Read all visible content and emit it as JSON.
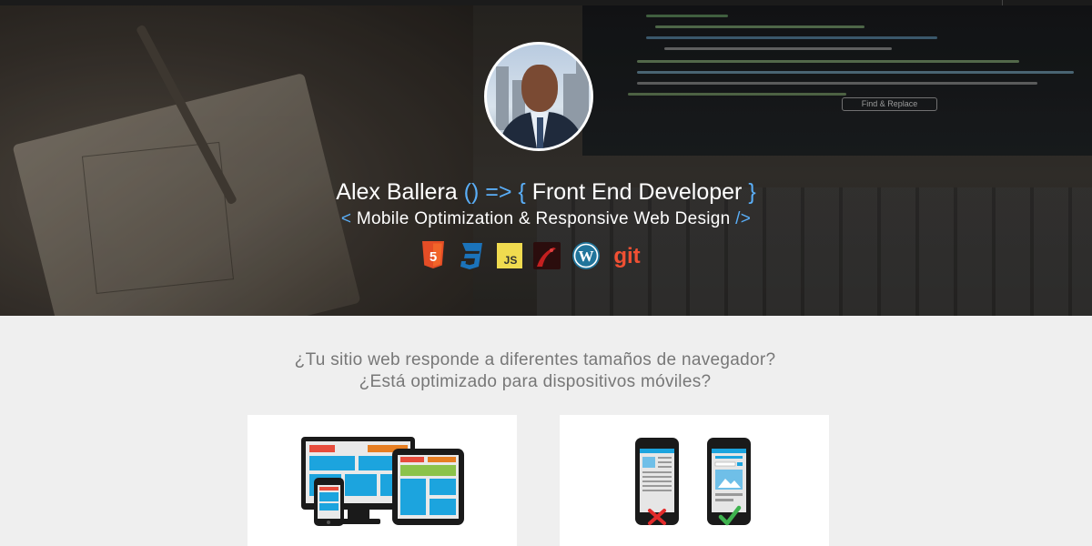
{
  "hero": {
    "find_button_label": "Find & Replace",
    "avatar_alt": "Alex Ballera",
    "headline": {
      "name": "Alex Ballera",
      "arrow": "() =>",
      "brace_open": "{",
      "role": "Front End Developer",
      "brace_close": "}"
    },
    "subline": {
      "tag_open": "<",
      "text": "Mobile Optimization & Responsive Web Design",
      "tag_close": "/>"
    },
    "tech_icons": [
      {
        "name": "html5-icon",
        "label": "5",
        "color": "#e44d26"
      },
      {
        "name": "css3-icon",
        "label": "3",
        "color": "#1b73ba"
      },
      {
        "name": "javascript-icon",
        "label": "JS",
        "color": "#f0db4f"
      },
      {
        "name": "rails-icon",
        "label": "",
        "color": "#b01c1c"
      },
      {
        "name": "wordpress-icon",
        "label": "W",
        "color": "#21759b"
      },
      {
        "name": "git-icon",
        "label": "git",
        "color": "#f05033"
      }
    ]
  },
  "section": {
    "question_line1": "¿Tu sitio web responde a diferentes tamaños de navegador?",
    "question_line2": "¿Está optimizado para dispositivos móviles?"
  },
  "cards": [
    {
      "name": "responsive-devices-card",
      "icon": "responsive-devices-icon"
    },
    {
      "name": "mobile-optimization-card",
      "icon": "mobile-comparison-icon"
    }
  ],
  "colors": {
    "accent": "#5aaef7",
    "page_bg": "#efefef",
    "question_text": "#777777",
    "wrong_mark": "#e32b2b",
    "right_mark": "#3fb34f"
  }
}
